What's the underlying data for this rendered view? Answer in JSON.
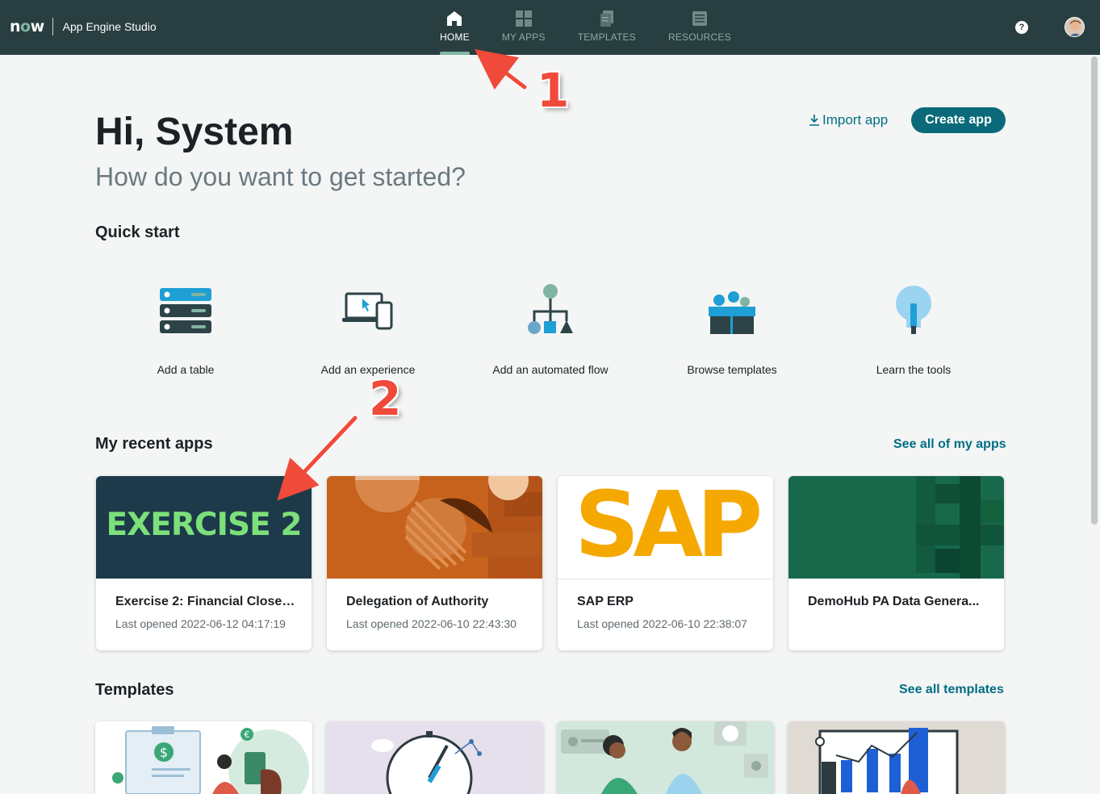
{
  "header": {
    "logo_text": "now",
    "app_name": "App Engine Studio",
    "nav": [
      {
        "label": "HOME",
        "icon": "home-icon",
        "active": true
      },
      {
        "label": "MY APPS",
        "icon": "grid-icon",
        "active": false
      },
      {
        "label": "TEMPLATES",
        "icon": "templates-icon",
        "active": false
      },
      {
        "label": "RESOURCES",
        "icon": "resources-icon",
        "active": false
      }
    ],
    "help_label": "?"
  },
  "hero": {
    "greeting": "Hi, System",
    "subtitle": "How do you want to get started?",
    "import_label": "Import app",
    "create_label": "Create app"
  },
  "quick_start": {
    "title": "Quick start",
    "items": [
      {
        "label": "Add a table",
        "icon": "table-icon"
      },
      {
        "label": "Add an experience",
        "icon": "devices-icon"
      },
      {
        "label": "Add an automated flow",
        "icon": "flow-icon"
      },
      {
        "label": "Browse templates",
        "icon": "box-icon"
      },
      {
        "label": "Learn the tools",
        "icon": "lightbulb-icon"
      }
    ]
  },
  "recent_apps": {
    "title": "My recent apps",
    "see_all": "See all of my apps",
    "apps": [
      {
        "title": "Exercise 2: Financial Close ...",
        "opened": "Last opened 2022-06-12 04:17:19",
        "banner_text": "EXERCISE 2"
      },
      {
        "title": "Delegation of Authority",
        "opened": "Last opened 2022-06-10 22:43:30"
      },
      {
        "title": "SAP ERP",
        "opened": "Last opened 2022-06-10 22:38:07",
        "banner_text": "SAP"
      },
      {
        "title": "DemoHub PA Data Genera...",
        "opened": ""
      }
    ]
  },
  "templates": {
    "title": "Templates",
    "see_all": "See all templates"
  },
  "annotations": [
    "1",
    "2"
  ],
  "colors": {
    "header_bg": "#293e40",
    "accent": "#81b5a1",
    "primary_button": "#0a6a7a",
    "link": "#006e84",
    "annotation": "#f04a3a"
  }
}
